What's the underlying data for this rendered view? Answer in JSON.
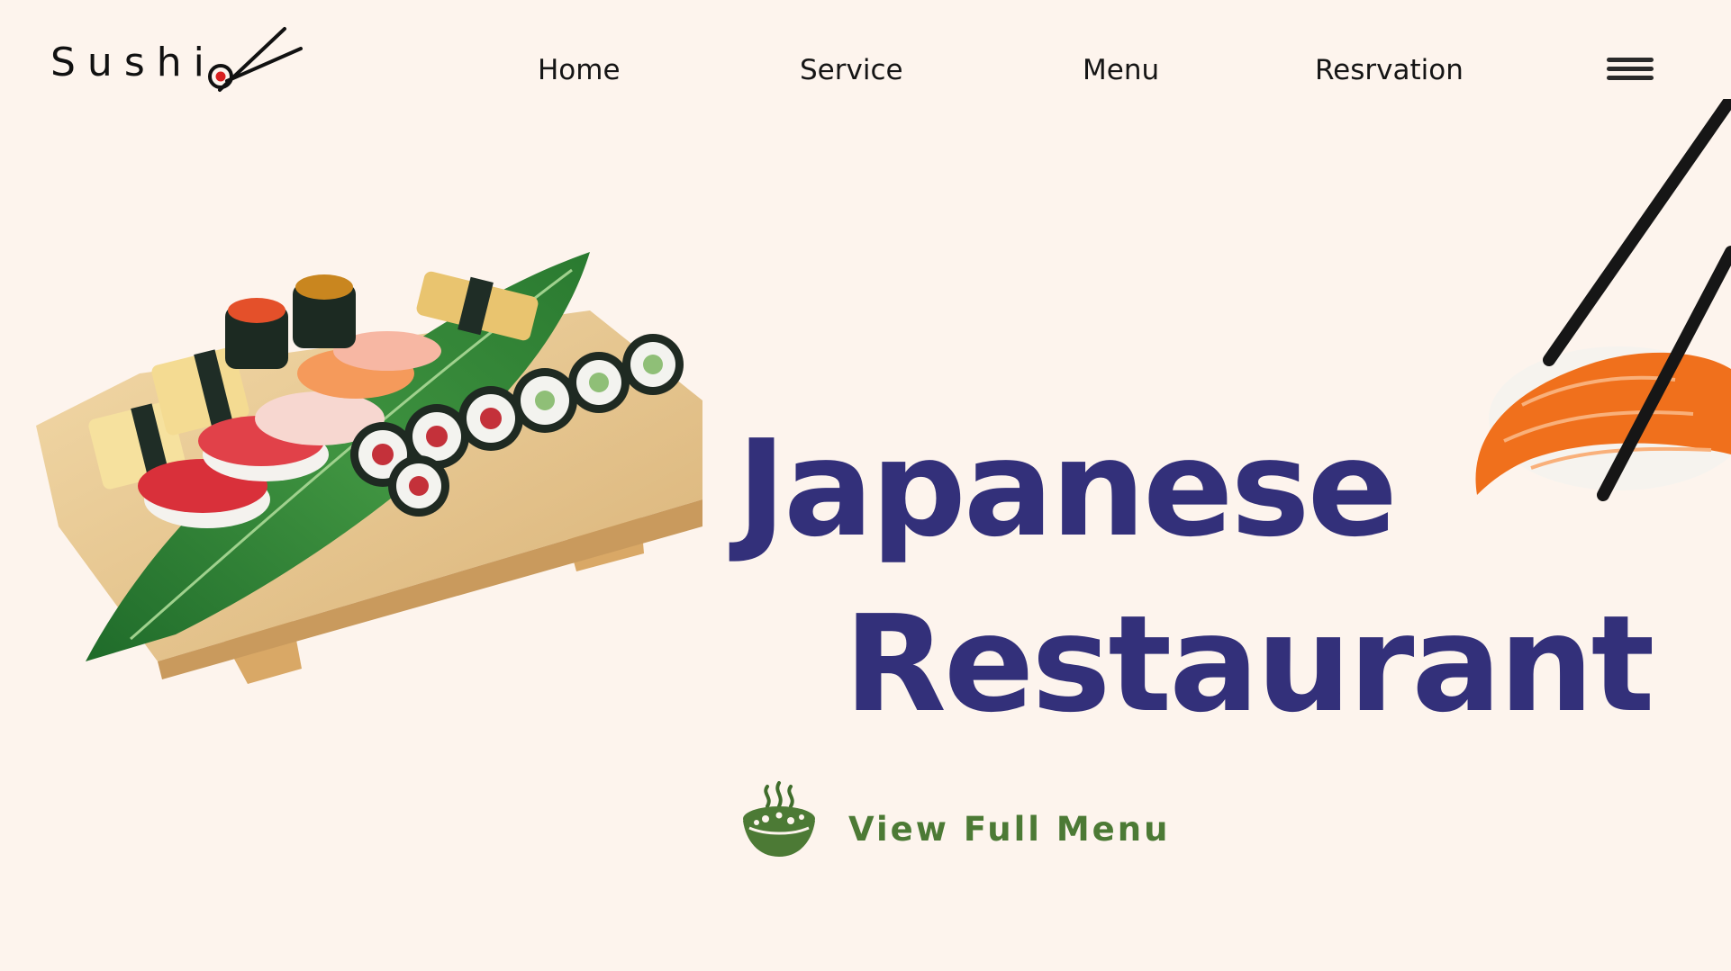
{
  "brand": {
    "name": "Sushi",
    "accent_color": "#d81f1f"
  },
  "nav": {
    "items": [
      {
        "label": "Home"
      },
      {
        "label": "Service"
      },
      {
        "label": "Menu"
      },
      {
        "label": "Resrvation"
      }
    ],
    "menu_icon": "hamburger-menu-icon"
  },
  "hero": {
    "title_line1": "Japanese",
    "title_line2": "Restaurant",
    "title_color": "#33307a",
    "cta_label": "View Full Menu",
    "cta_color": "#4c7a35",
    "cta_icon": "steaming-bowl-icon"
  },
  "images": {
    "left": "sushi-platter-on-wooden-board",
    "right": "chopsticks-holding-salmon-nigiri"
  },
  "colors": {
    "background": "#fdf4ed"
  }
}
